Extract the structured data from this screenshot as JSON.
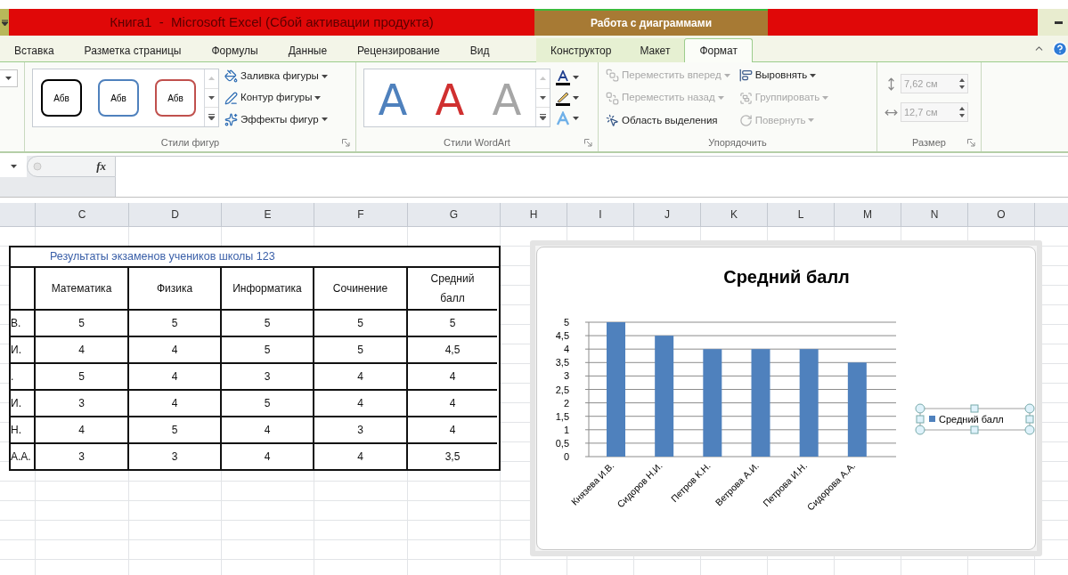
{
  "title_bar": {
    "title": "Книга1  -  Microsoft Excel (Сбой активации продукта)",
    "context_title": "Работа с диаграммами"
  },
  "tabs": [
    {
      "label": "Вставка",
      "selected": false,
      "contextual": false
    },
    {
      "label": "Разметка страницы",
      "selected": false,
      "contextual": false
    },
    {
      "label": "Формулы",
      "selected": false,
      "contextual": false
    },
    {
      "label": "Данные",
      "selected": false,
      "contextual": false
    },
    {
      "label": "Рецензирование",
      "selected": false,
      "contextual": false
    },
    {
      "label": "Вид",
      "selected": false,
      "contextual": false
    },
    {
      "label": "Конструктор",
      "selected": false,
      "contextual": true
    },
    {
      "label": "Макет",
      "selected": false,
      "contextual": true
    },
    {
      "label": "Формат",
      "selected": true,
      "contextual": true
    }
  ],
  "ribbon": {
    "shape_styles": {
      "label": "Стили фигур",
      "presets": [
        {
          "text": "Абв",
          "color": "#000000"
        },
        {
          "text": "Абв",
          "color": "#4f81bd"
        },
        {
          "text": "Абв",
          "color": "#c0504d"
        }
      ],
      "commands": [
        {
          "label": "Заливка фигуры",
          "dropdown": true
        },
        {
          "label": "Контур фигуры",
          "dropdown": true
        },
        {
          "label": "Эффекты фигур",
          "dropdown": true
        }
      ]
    },
    "wordart_styles": {
      "label": "Стили WordArt",
      "presets": [
        {
          "text": "A",
          "color": "#4f81bd"
        },
        {
          "text": "A",
          "color": "#d03030"
        },
        {
          "text": "A",
          "color": "#a6a6a6"
        }
      ]
    },
    "arrange": {
      "label": "Упорядочить",
      "commands": [
        {
          "label": "Переместить вперед",
          "dropdown": true,
          "disabled": true
        },
        {
          "label": "Переместить назад",
          "dropdown": true,
          "disabled": true
        },
        {
          "label": "Область выделения",
          "dropdown": false,
          "disabled": false
        },
        {
          "label": "Выровнять",
          "dropdown": true,
          "disabled": false
        },
        {
          "label": "Группировать",
          "dropdown": true,
          "disabled": true
        },
        {
          "label": "Повернуть",
          "dropdown": true,
          "disabled": true
        }
      ]
    },
    "size": {
      "label": "Размер",
      "fields": [
        {
          "value": "7,62 см",
          "disabled": true
        },
        {
          "value": "12,7 см",
          "disabled": true
        }
      ]
    }
  },
  "formula_bar": {
    "function_label": "fx"
  },
  "sheet": {
    "columns": [
      "C",
      "D",
      "E",
      "F",
      "G",
      "H",
      "I",
      "J",
      "K",
      "L",
      "M",
      "N",
      "O"
    ]
  },
  "table": {
    "title": "Результаты экзаменов учеников школы 123",
    "headers": [
      "Математика",
      "Физика",
      "Информатика",
      "Сочинение",
      "Средний балл"
    ],
    "rows": [
      {
        "name": "В.",
        "scores": [
          "5",
          "5",
          "5",
          "5",
          "5"
        ]
      },
      {
        "name": "И.",
        "scores": [
          "4",
          "4",
          "5",
          "5",
          "4,5"
        ]
      },
      {
        "name": ".",
        "scores": [
          "5",
          "4",
          "3",
          "4",
          "4"
        ]
      },
      {
        "name": "И.",
        "scores": [
          "3",
          "4",
          "5",
          "4",
          "4"
        ]
      },
      {
        "name": "Н.",
        "scores": [
          "4",
          "5",
          "4",
          "3",
          "4"
        ]
      },
      {
        "name": "А.А.",
        "scores": [
          "3",
          "3",
          "4",
          "4",
          "3,5"
        ]
      }
    ]
  },
  "chart": {
    "legend_selected": true,
    "chart_data": {
      "type": "bar",
      "grid": true,
      "title": "Средний балл",
      "categories": [
        "Князева И.В.",
        "Сидоров Н.И.",
        "Петров К.Н.",
        "Ветрова А.И.",
        "Петрова И.Н.",
        "Сидорова А.А."
      ],
      "series": [
        {
          "name": "Средний балл",
          "color": "#4f81bd",
          "values": [
            5,
            4.5,
            4,
            4,
            4,
            3.5
          ]
        }
      ],
      "ylim": [
        0,
        5
      ],
      "yticks": [
        {
          "value": 0,
          "label": "0"
        },
        {
          "value": 0.5,
          "label": "0,5"
        },
        {
          "value": 1,
          "label": "1"
        },
        {
          "value": 1.5,
          "label": "1,5"
        },
        {
          "value": 2,
          "label": "2"
        },
        {
          "value": 2.5,
          "label": "2,5"
        },
        {
          "value": 3,
          "label": "3"
        },
        {
          "value": 3.5,
          "label": "3,5"
        },
        {
          "value": 4,
          "label": "4"
        },
        {
          "value": 4.5,
          "label": "4,5"
        },
        {
          "value": 5,
          "label": "5"
        }
      ]
    }
  }
}
